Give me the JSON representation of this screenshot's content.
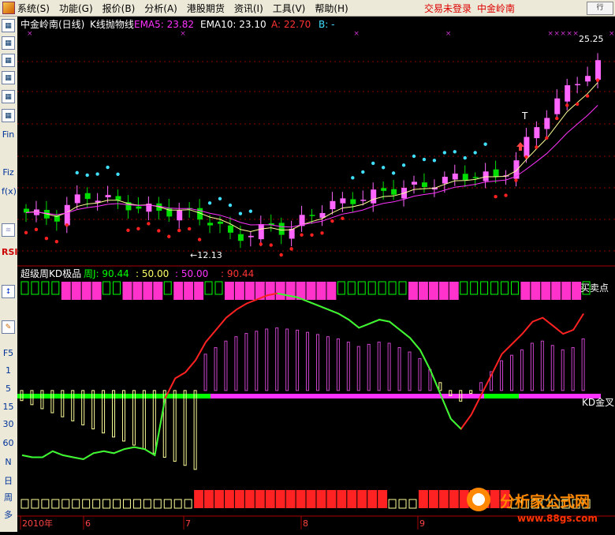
{
  "menubar": {
    "items": [
      "系统(S)",
      "功能(G)",
      "报价(B)",
      "分析(A)",
      "港股期货",
      "资讯(I)",
      "工具(V)",
      "帮助(H)"
    ],
    "login_status": "交易未登录",
    "stock_name": "中金岭南",
    "window_button": "行"
  },
  "toolbar": {
    "text_buttons": [
      "Fin",
      "Fiz",
      "f(x)",
      "RSI",
      "F5",
      "1",
      "5",
      "15",
      "30",
      "60",
      "N",
      "日",
      "周",
      "多"
    ]
  },
  "main_chart": {
    "title": "中金岭南(日线)",
    "indicator_name": "K线抛物线",
    "ema5_label": "EMA5: 23.82",
    "ema10_label": "EMA10: 23.10",
    "a_label": "A: 22.70",
    "b_label": "B: -",
    "high_label": "25.25",
    "low_label": "←12.13",
    "t_marker": "T"
  },
  "sub_chart": {
    "title": "超级周KD极品",
    "j_label": "周J: 90.44",
    "v1_label": ": 50.00",
    "v2_label": ": 50.00",
    "v3_label": ": 90.44",
    "buy_point_label": "买卖点",
    "kd_cross_label": "KD金叉"
  },
  "date_axis": {
    "labels": [
      "2010年",
      "6",
      "7",
      "8",
      "9"
    ]
  },
  "watermark": {
    "brand": "分析家公式网",
    "url": "www.88gs.com"
  },
  "colors": {
    "bull": "#ff66ff",
    "bear": "#00dd00",
    "sar_up": "#ff2020",
    "sar_down": "#40e0ff",
    "ema5": "#ffff99",
    "ema10": "#ff33ff",
    "menu_bg": "#ece9d8"
  },
  "chart_data": {
    "type": "line",
    "price_range": [
      11.5,
      26.0
    ],
    "kd_range": [
      -5,
      105
    ],
    "j_series": [
      20,
      19,
      19,
      22,
      20,
      19,
      18,
      21,
      22,
      21,
      23,
      24,
      23,
      20,
      48,
      58,
      61,
      67,
      76,
      82,
      88,
      92,
      95,
      97,
      99,
      100,
      99,
      98,
      96,
      94,
      92,
      90,
      87,
      83,
      85,
      87,
      86,
      82,
      78,
      72,
      62,
      50,
      38,
      33,
      40,
      50,
      60,
      70,
      75,
      80,
      86,
      88,
      84,
      80,
      82,
      90
    ]
  }
}
